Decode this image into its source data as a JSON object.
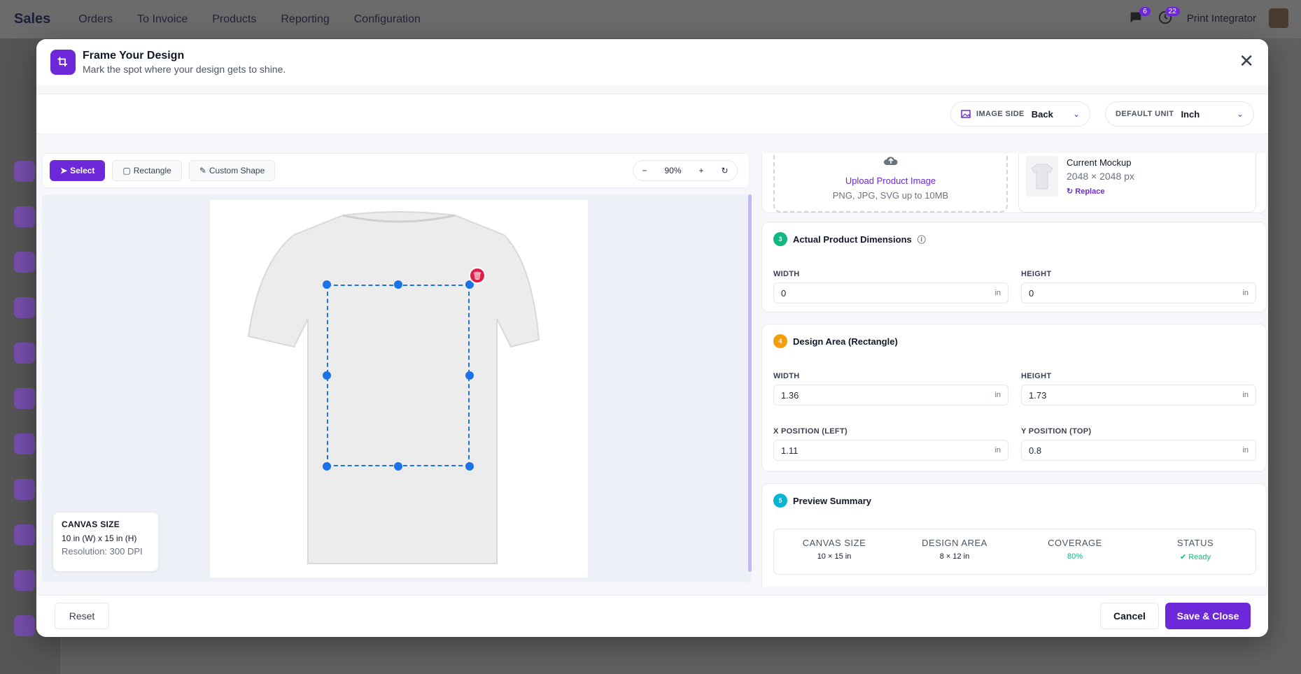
{
  "app": {
    "title": "Sales",
    "nav": [
      "Orders",
      "To Invoice",
      "Products",
      "Reporting",
      "Configuration"
    ],
    "messages_count": "6",
    "activities_count": "22",
    "user_name": "Print Integrator"
  },
  "modal": {
    "title": "Frame Your Design",
    "subtitle": "Mark the spot where your design gets to shine.",
    "image_side": {
      "label": "IMAGE SIDE",
      "value": "Back"
    },
    "default_unit": {
      "label": "DEFAULT UNIT",
      "value": "Inch"
    },
    "tools": {
      "select": "Select",
      "rectangle": "Rectangle",
      "custom_shape": "Custom Shape"
    },
    "zoom": "90%",
    "canvas_info": {
      "title": "CANVAS SIZE",
      "size": "10 in (W) x 15 in (H)",
      "resolution": "Resolution: 300 DPI"
    },
    "upload": {
      "title": "Upload Product Image",
      "subtitle": "PNG, JPG, SVG up to 10MB"
    },
    "mockup": {
      "title": "Current Mockup",
      "size": "2048 × 2048 px",
      "replace": "Replace"
    },
    "product_dimensions": {
      "step": "3",
      "title": "Actual Product Dimensions",
      "width_label": "WIDTH",
      "width": "0",
      "height_label": "HEIGHT",
      "height": "0",
      "unit": "in"
    },
    "design_area": {
      "step": "4",
      "title": "Design Area (Rectangle)",
      "width_label": "WIDTH",
      "width": "1.36",
      "height_label": "HEIGHT",
      "height": "1.73",
      "x_label": "X POSITION (LEFT)",
      "x": "1.11",
      "y_label": "Y POSITION (TOP)",
      "y": "0.8",
      "unit": "in"
    },
    "summary": {
      "step": "5",
      "title": "Preview Summary",
      "canvas_label": "CANVAS SIZE",
      "canvas_value": "10 × 15 in",
      "design_label": "DESIGN AREA",
      "design_value": "8 × 12 in",
      "coverage_label": "COVERAGE",
      "coverage_value": "80%",
      "status_label": "STATUS",
      "status_value": "Ready"
    },
    "buttons": {
      "reset": "Reset",
      "cancel": "Cancel",
      "save": "Save & Close"
    }
  },
  "colors": {
    "accent": "#6d28d9",
    "selection": "#1a73e8",
    "delete": "#e11d48",
    "success": "#10b981"
  }
}
